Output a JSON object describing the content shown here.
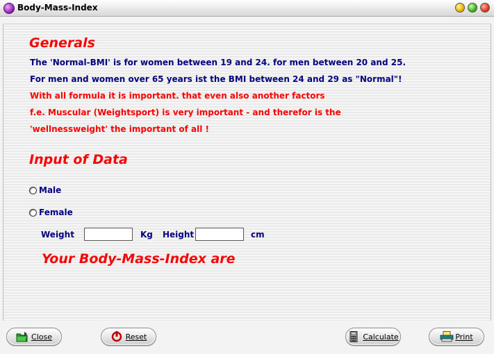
{
  "window": {
    "title": "Body-Mass-Index"
  },
  "generals": {
    "heading": "Generals",
    "lines": [
      "The 'Normal-BMI' is for women between 19 and 24. for men between 20 and 25.",
      "For men and women over 65 years ist the BMI between 24 and 29 as \"Normal\"!",
      "With all formula it is important. that even also another factors",
      "f.e. Muscular (Weightsport) is very important - and therefor is the",
      "'wellnessweight' the important of all !"
    ]
  },
  "input": {
    "heading": "Input of Data",
    "male_label": "Male",
    "female_label": "Female",
    "weight_label": "Weight",
    "weight_value": "",
    "weight_unit": "Kg",
    "height_label": "Height",
    "height_value": "",
    "height_unit": "cm"
  },
  "result": {
    "label": "Your Body-Mass-Index are"
  },
  "buttons": {
    "close": "Close",
    "reset": "Reset",
    "calculate": "Calculate",
    "print": "Print"
  },
  "colors": {
    "heading_red": "#ff0000",
    "text_blue": "#000080"
  }
}
